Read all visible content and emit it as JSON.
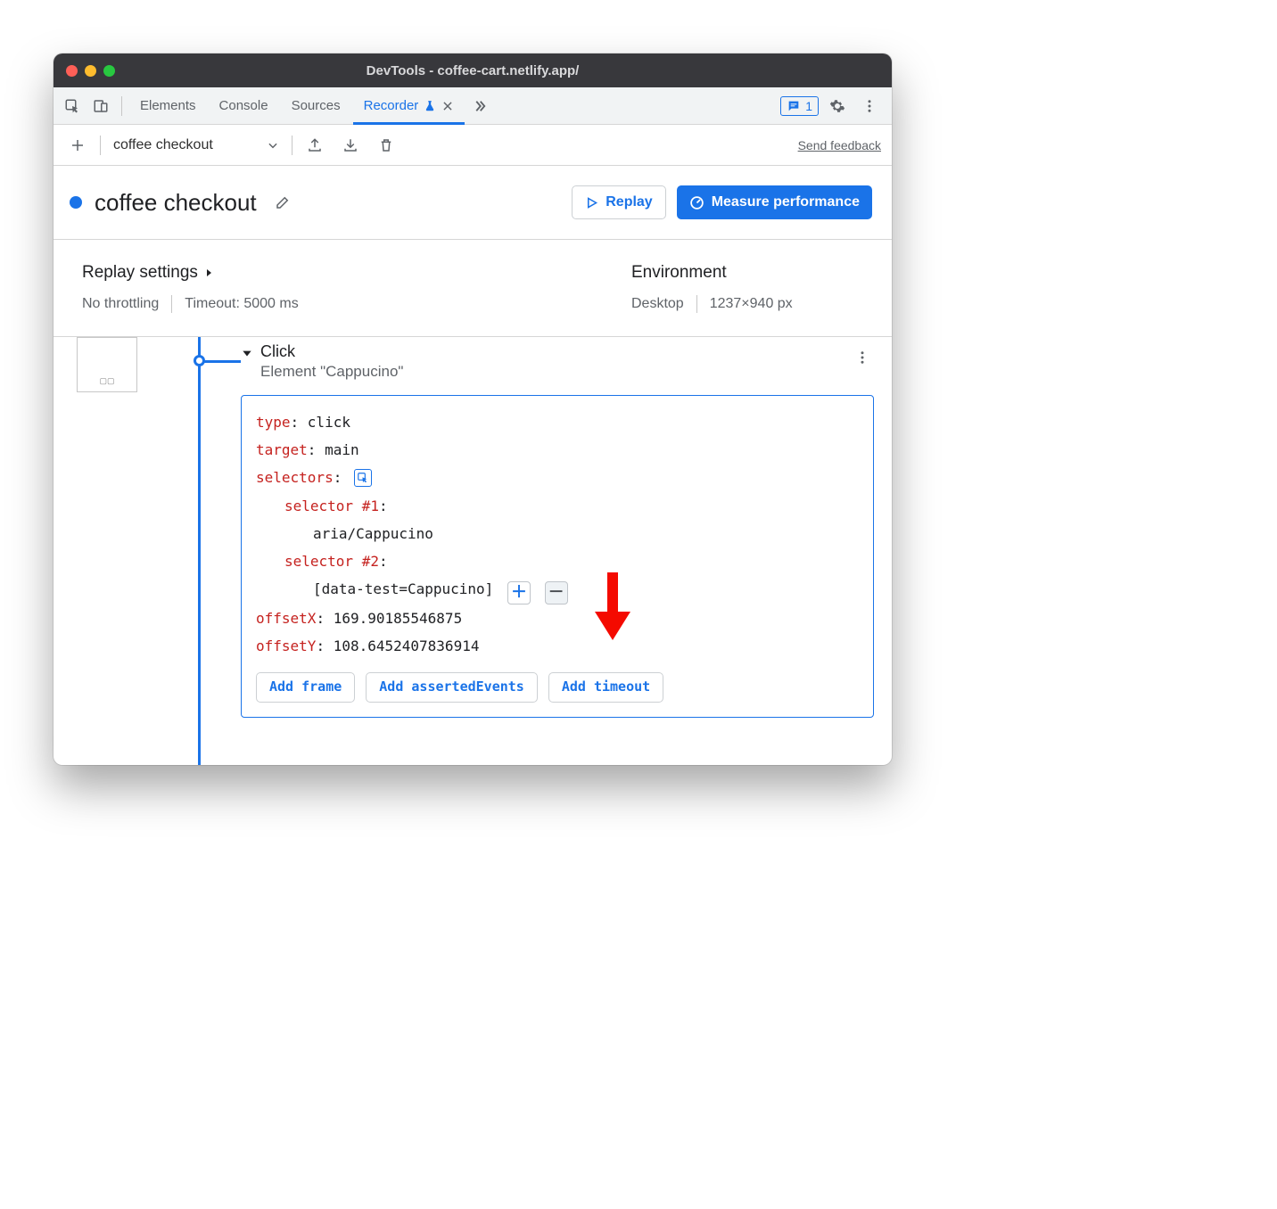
{
  "window": {
    "title": "DevTools - coffee-cart.netlify.app/"
  },
  "tabs": {
    "elements": "Elements",
    "console": "Console",
    "sources": "Sources",
    "recorder": "Recorder",
    "issues_count": "1"
  },
  "toolbar": {
    "recording_name": "coffee checkout",
    "feedback": "Send feedback"
  },
  "header": {
    "title": "coffee checkout",
    "replay_btn": "Replay",
    "perf_btn": "Measure performance"
  },
  "settings": {
    "replay_heading": "Replay settings",
    "throttling": "No throttling",
    "timeout": "Timeout: 5000 ms",
    "env_heading": "Environment",
    "device": "Desktop",
    "viewport": "1237×940 px"
  },
  "step": {
    "action": "Click",
    "subtitle": "Element \"Cappucino\"",
    "type_key": "type",
    "type_val": "click",
    "target_key": "target",
    "target_val": "main",
    "selectors_key": "selectors",
    "sel1_key": "selector #1",
    "sel1_val": "aria/Cappucino",
    "sel2_key": "selector #2",
    "sel2_val": "[data-test=Cappucino]",
    "offx_key": "offsetX",
    "offx_val": "169.90185546875",
    "offy_key": "offsetY",
    "offy_val": "108.6452407836914",
    "add_frame": "Add frame",
    "add_asserted": "Add assertedEvents",
    "add_timeout": "Add timeout"
  }
}
